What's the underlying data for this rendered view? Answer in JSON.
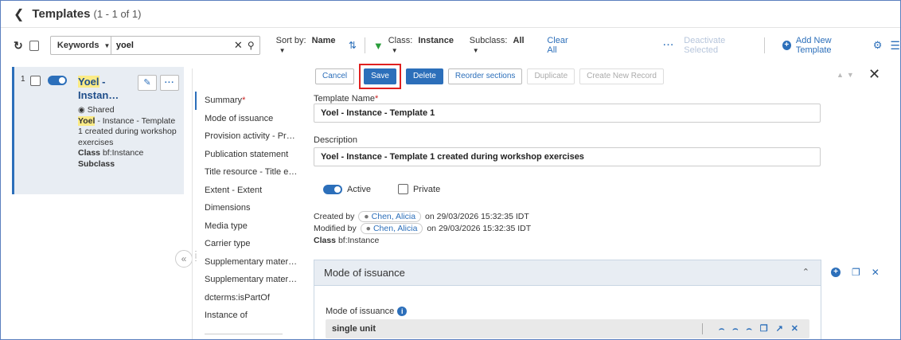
{
  "header": {
    "title": "Templates",
    "count": "(1 - 1 of 1)"
  },
  "toolbar": {
    "search_type": "Keywords",
    "search_value": "yoel",
    "sort_label": "Sort by:",
    "sort_value": "Name",
    "class_label": "Class:",
    "class_value": "Instance",
    "subclass_label": "Subclass:",
    "subclass_value": "All",
    "clear_all": "Clear All",
    "deactivate_selected": "Deactivate Selected",
    "add_new_template": "Add New Template"
  },
  "list": {
    "row_number": "1",
    "title_highlight": "Yoel",
    "title_rest_1": " -",
    "title_rest_2": "Instan…",
    "shared_label": "Shared",
    "desc_highlight": "Yoel",
    "desc_rest": " - Instance - Template 1 created during workshop exercises",
    "class_label": "Class",
    "class_value": " bf:Instance",
    "subclass_label": "Subclass"
  },
  "sections": [
    {
      "label": "Summary",
      "required": "*"
    },
    {
      "label": "Mode of issuance"
    },
    {
      "label": "Provision activity - Pro…"
    },
    {
      "label": "Publication statement"
    },
    {
      "label": "Title resource - Title e…"
    },
    {
      "label": "Extent - Extent"
    },
    {
      "label": "Dimensions"
    },
    {
      "label": "Media type"
    },
    {
      "label": "Carrier type"
    },
    {
      "label": "Supplementary materi…"
    },
    {
      "label": "Supplementary materi…"
    },
    {
      "label": "dcterms:isPartOf"
    },
    {
      "label": "Instance of"
    }
  ],
  "actions": {
    "cancel": "Cancel",
    "save": "Save",
    "delete": "Delete",
    "reorder": "Reorder sections",
    "duplicate": "Duplicate",
    "create_new_record": "Create New Record"
  },
  "form": {
    "template_name_label": "Template Name",
    "required_mark": "*",
    "template_name_value": "Yoel - Instance - Template 1",
    "description_label": "Description",
    "description_value": "Yoel - Instance - Template 1 created during workshop exercises",
    "active_label": "Active",
    "private_label": "Private",
    "created_by_label": "Created by",
    "created_by_user": "Chen, Alicia",
    "created_on": "on 29/03/2026 15:32:35 IDT",
    "modified_by_label": "Modified by",
    "modified_by_user": "Chen, Alicia",
    "modified_on": "on 29/03/2026 15:32:35 IDT",
    "class_label": "Class",
    "class_value": " bf:Instance"
  },
  "panel": {
    "title": "Mode of issuance",
    "field_label": "Mode of issuance",
    "field_value": "single unit"
  },
  "colors": {
    "accent": "#2c6fba",
    "highlight": "#fbeb86",
    "save_outline": "#e0201f"
  }
}
